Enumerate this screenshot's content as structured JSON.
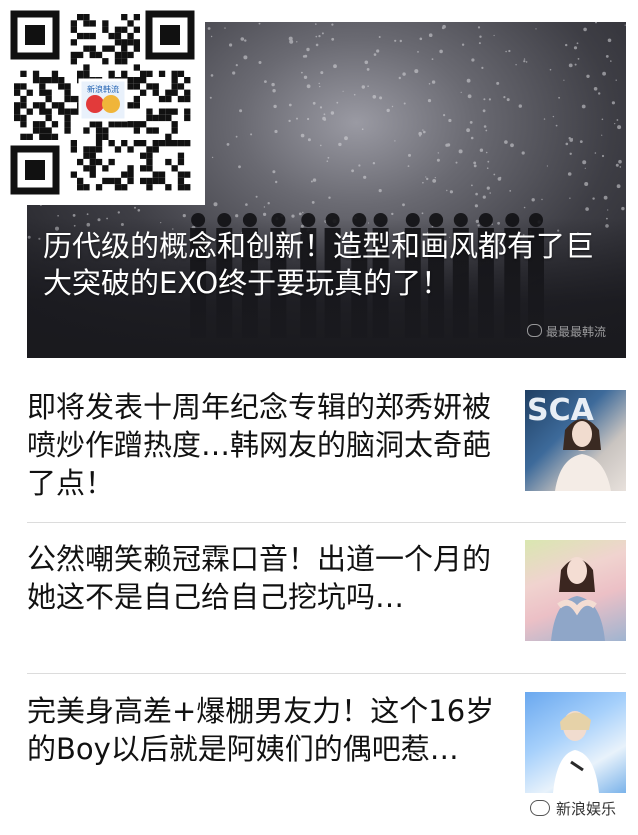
{
  "hero": {
    "title": "历代级的概念和创新！造型和画风都有了巨大突破的EXO终于要玩真的了！",
    "watermark": "最最最韩流"
  },
  "qr": {
    "badge_text": "新浪韩流"
  },
  "articles": [
    {
      "title": "即将发表十周年纪念专辑的郑秀妍被喷炒作蹭热度…韩网友的脑洞太奇葩了点！",
      "thumb_icon": "photo-jessica",
      "thumb_text": "SCA"
    },
    {
      "title": "公然嘲笑赖冠霖口音！出道一个月的她这不是自己给自己挖坑吗…",
      "thumb_icon": "photo-idol-girl"
    },
    {
      "title": "完美身高差+爆棚男友力！这个16岁的Boy以后就是阿姨们的偶吧惹…",
      "thumb_icon": "photo-boy"
    }
  ],
  "footer": {
    "watermark": "新浪娱乐"
  },
  "colors": {
    "text": "#111111",
    "divider": "#dcdcdc",
    "hero_text": "#ffffff"
  }
}
